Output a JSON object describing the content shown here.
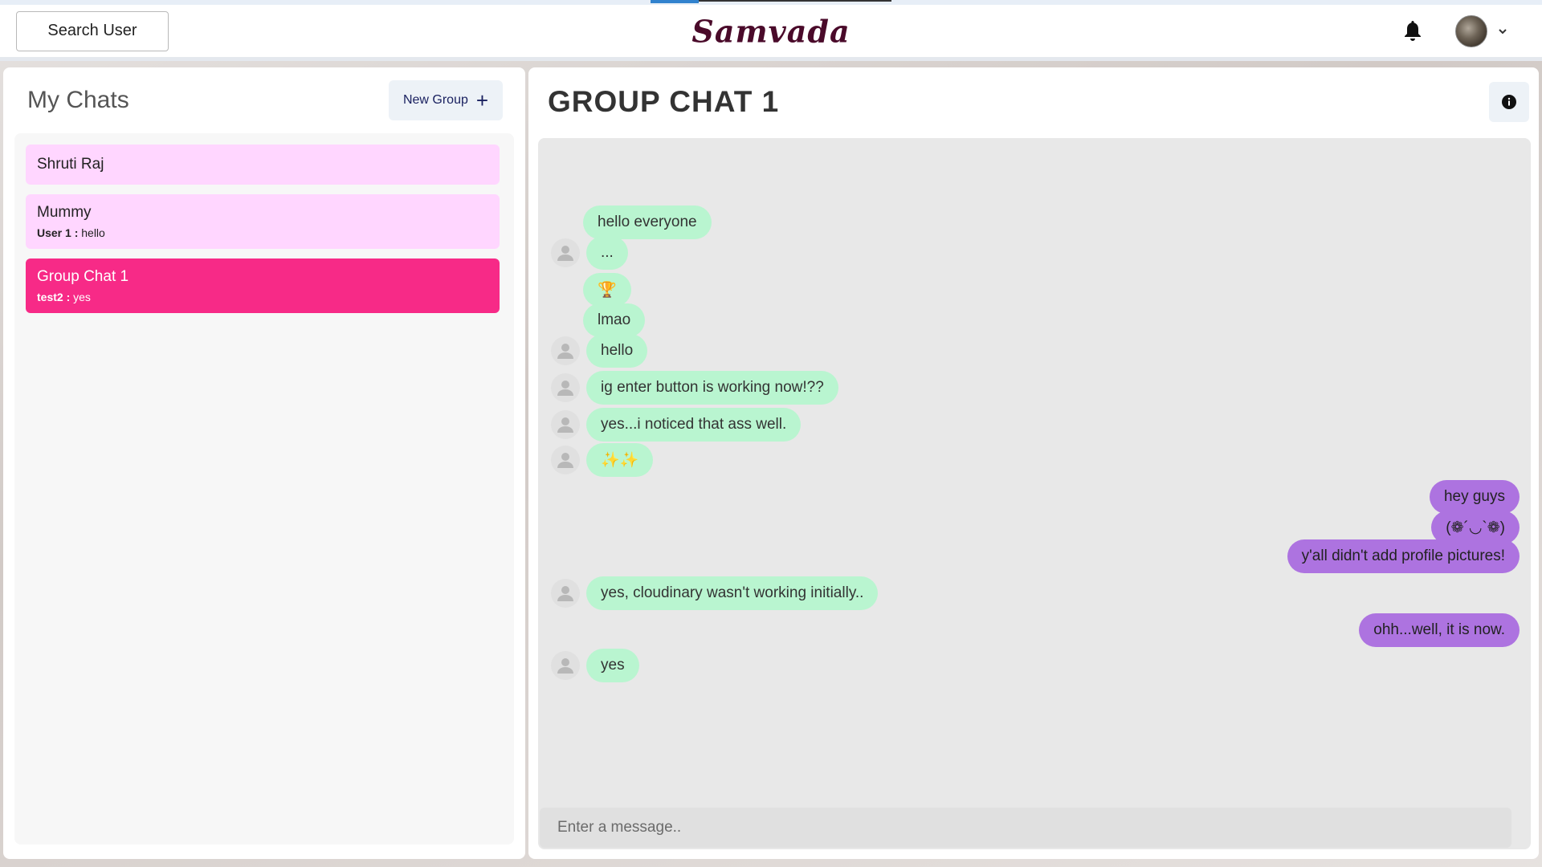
{
  "header": {
    "search_label": "Search User",
    "brand": "Samvada"
  },
  "left": {
    "title": "My Chats",
    "new_group_label": "New Group",
    "chats": [
      {
        "name": "Shruti Raj",
        "sender": "",
        "message": "",
        "active": false
      },
      {
        "name": "Mummy",
        "sender": "User 1 :",
        "message": "hello",
        "active": false
      },
      {
        "name": "Group Chat 1",
        "sender": "test2 :",
        "message": "yes",
        "active": true
      }
    ]
  },
  "chat": {
    "title": "GROUP CHAT 1",
    "composer_placeholder": "Enter a message..",
    "messages": [
      {
        "text": "hello everyone",
        "dir": "in",
        "avatar": false
      },
      {
        "text": "...",
        "dir": "in",
        "avatar": true
      },
      {
        "text": "🏆",
        "dir": "in",
        "avatar": false
      },
      {
        "text": "lmao",
        "dir": "in",
        "avatar": false
      },
      {
        "text": "hello",
        "dir": "in",
        "avatar": true
      },
      {
        "text": "ig enter button is working now!??",
        "dir": "in",
        "avatar": true
      },
      {
        "text": "yes...i noticed that ass well.",
        "dir": "in",
        "avatar": true
      },
      {
        "text": "✨✨",
        "dir": "in",
        "avatar": true
      },
      {
        "text": "hey guys",
        "dir": "out",
        "avatar": false
      },
      {
        "text": "(❁´◡`❁)",
        "dir": "out",
        "avatar": false
      },
      {
        "text": "y'all didn't add profile pictures!",
        "dir": "out",
        "avatar": false
      },
      {
        "text": "yes, cloudinary wasn't working initially..",
        "dir": "in",
        "avatar": true
      },
      {
        "text": "ohh...well, it is now.",
        "dir": "out",
        "avatar": false
      },
      {
        "text": "yes",
        "dir": "in",
        "avatar": true
      }
    ]
  },
  "colors": {
    "active_chat": "#f72a87",
    "chat_item": "#ffd6ff",
    "incoming_bubble": "#b9f5d0",
    "outgoing_bubble": "#ad73e0"
  },
  "icons": {
    "bell": "bell-icon",
    "info": "info-icon",
    "plus": "plus-icon",
    "chevron": "chevron-down-icon",
    "user": "user-avatar-icon"
  }
}
